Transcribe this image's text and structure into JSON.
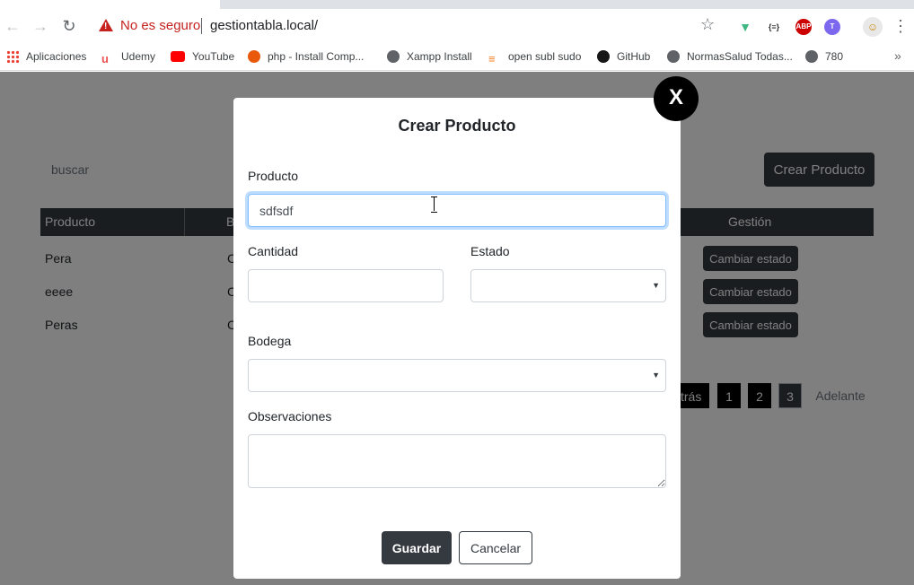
{
  "browser": {
    "security_text": "No es seguro",
    "url": "gestiontabla.local/",
    "bookmarks": [
      {
        "label": "Aplicaciones",
        "icon": "apps-grid-icon"
      },
      {
        "label": "Udemy",
        "icon": "udemy-icon"
      },
      {
        "label": "YouTube",
        "icon": "youtube-icon"
      },
      {
        "label": "php - Install Comp...",
        "icon": "ask-icon"
      },
      {
        "label": "Xampp Install",
        "icon": "globe-icon"
      },
      {
        "label": "open subl sudo",
        "icon": "stackoverflow-icon"
      },
      {
        "label": "GitHub",
        "icon": "github-icon"
      },
      {
        "label": "NormasSalud Todas...",
        "icon": "globe-icon"
      },
      {
        "label": "780",
        "icon": "globe-icon"
      }
    ],
    "extensions": [
      "vue-devtools-icon",
      "json-viewer-icon",
      "adblock-plus-icon",
      "translate-icon",
      "profile-avatar-icon"
    ]
  },
  "page": {
    "search_label": "buscar",
    "create_button": "Crear Producto",
    "table": {
      "headers": [
        "Producto",
        "B",
        "Gestión"
      ],
      "rows": [
        {
          "producto": "Pera",
          "col2": "C",
          "action": "Cambiar estado"
        },
        {
          "producto": "eeee",
          "col2": "C",
          "action": "Cambiar estado"
        },
        {
          "producto": "Peras",
          "col2": "C",
          "action": "Cambiar estado"
        }
      ]
    },
    "pagination": {
      "prev": "Atrás",
      "pages": [
        "1",
        "2",
        "3"
      ],
      "active_page": "3",
      "next": "Adelante"
    }
  },
  "modal": {
    "title": "Crear Producto",
    "close_label": "X",
    "fields": {
      "producto": {
        "label": "Producto",
        "value": "sdfsdf"
      },
      "cantidad": {
        "label": "Cantidad",
        "value": ""
      },
      "estado": {
        "label": "Estado",
        "value": ""
      },
      "bodega": {
        "label": "Bodega",
        "value": ""
      },
      "observaciones": {
        "label": "Observaciones",
        "value": ""
      }
    },
    "save_button": "Guardar",
    "cancel_button": "Cancelar"
  },
  "colors": {
    "dark": "#343a40",
    "insecure_red": "#c5221f",
    "focus_blue": "#80bdff"
  }
}
